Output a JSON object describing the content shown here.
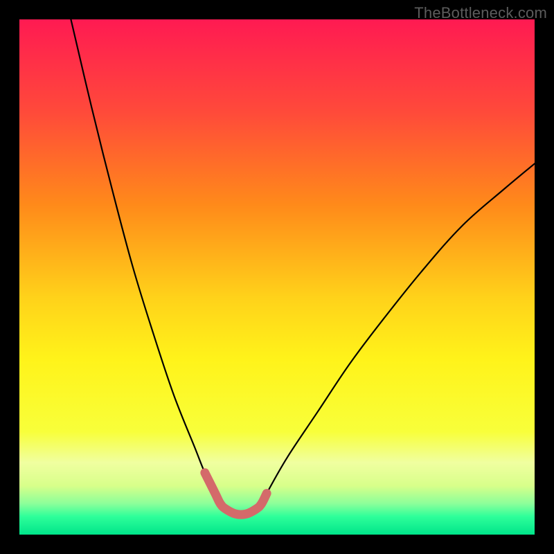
{
  "watermark": {
    "text": "TheBottleneck.com"
  },
  "colors": {
    "frame": "#000000",
    "watermark_text": "#5c5c5c",
    "gradient_stops": [
      {
        "offset": 0.0,
        "color": "#ff1a52"
      },
      {
        "offset": 0.18,
        "color": "#ff4a3a"
      },
      {
        "offset": 0.36,
        "color": "#ff8a1a"
      },
      {
        "offset": 0.54,
        "color": "#ffd21a"
      },
      {
        "offset": 0.66,
        "color": "#fff31a"
      },
      {
        "offset": 0.8,
        "color": "#f8ff3a"
      },
      {
        "offset": 0.86,
        "color": "#f0ffa0"
      },
      {
        "offset": 0.905,
        "color": "#d8ff8a"
      },
      {
        "offset": 0.94,
        "color": "#8bff9a"
      },
      {
        "offset": 0.965,
        "color": "#2eff9a"
      },
      {
        "offset": 1.0,
        "color": "#00e58a"
      }
    ],
    "curve_stroke": "#000000",
    "accent_stroke": "#d46a6a"
  },
  "chart_data": {
    "type": "line",
    "title": "",
    "xlabel": "",
    "ylabel": "",
    "xlim": [
      0,
      100
    ],
    "ylim": [
      0,
      100
    ],
    "grid": false,
    "series": [
      {
        "name": "curve",
        "x": [
          10,
          14,
          18,
          22,
          26,
          30,
          34,
          36,
          38,
          39,
          40,
          42,
          44,
          46,
          47,
          48,
          52,
          58,
          64,
          70,
          78,
          86,
          94,
          100
        ],
        "y": [
          100,
          83,
          67,
          52,
          39,
          27,
          17,
          12,
          8,
          6,
          5,
          4,
          4,
          5,
          6,
          8,
          15,
          24,
          33,
          41,
          51,
          60,
          67,
          72
        ]
      }
    ],
    "accent_region": {
      "x": [
        36,
        38,
        39,
        40,
        42,
        44,
        46,
        47,
        48
      ],
      "y": [
        12,
        8,
        6,
        5,
        4,
        4,
        5,
        6,
        8
      ]
    }
  }
}
